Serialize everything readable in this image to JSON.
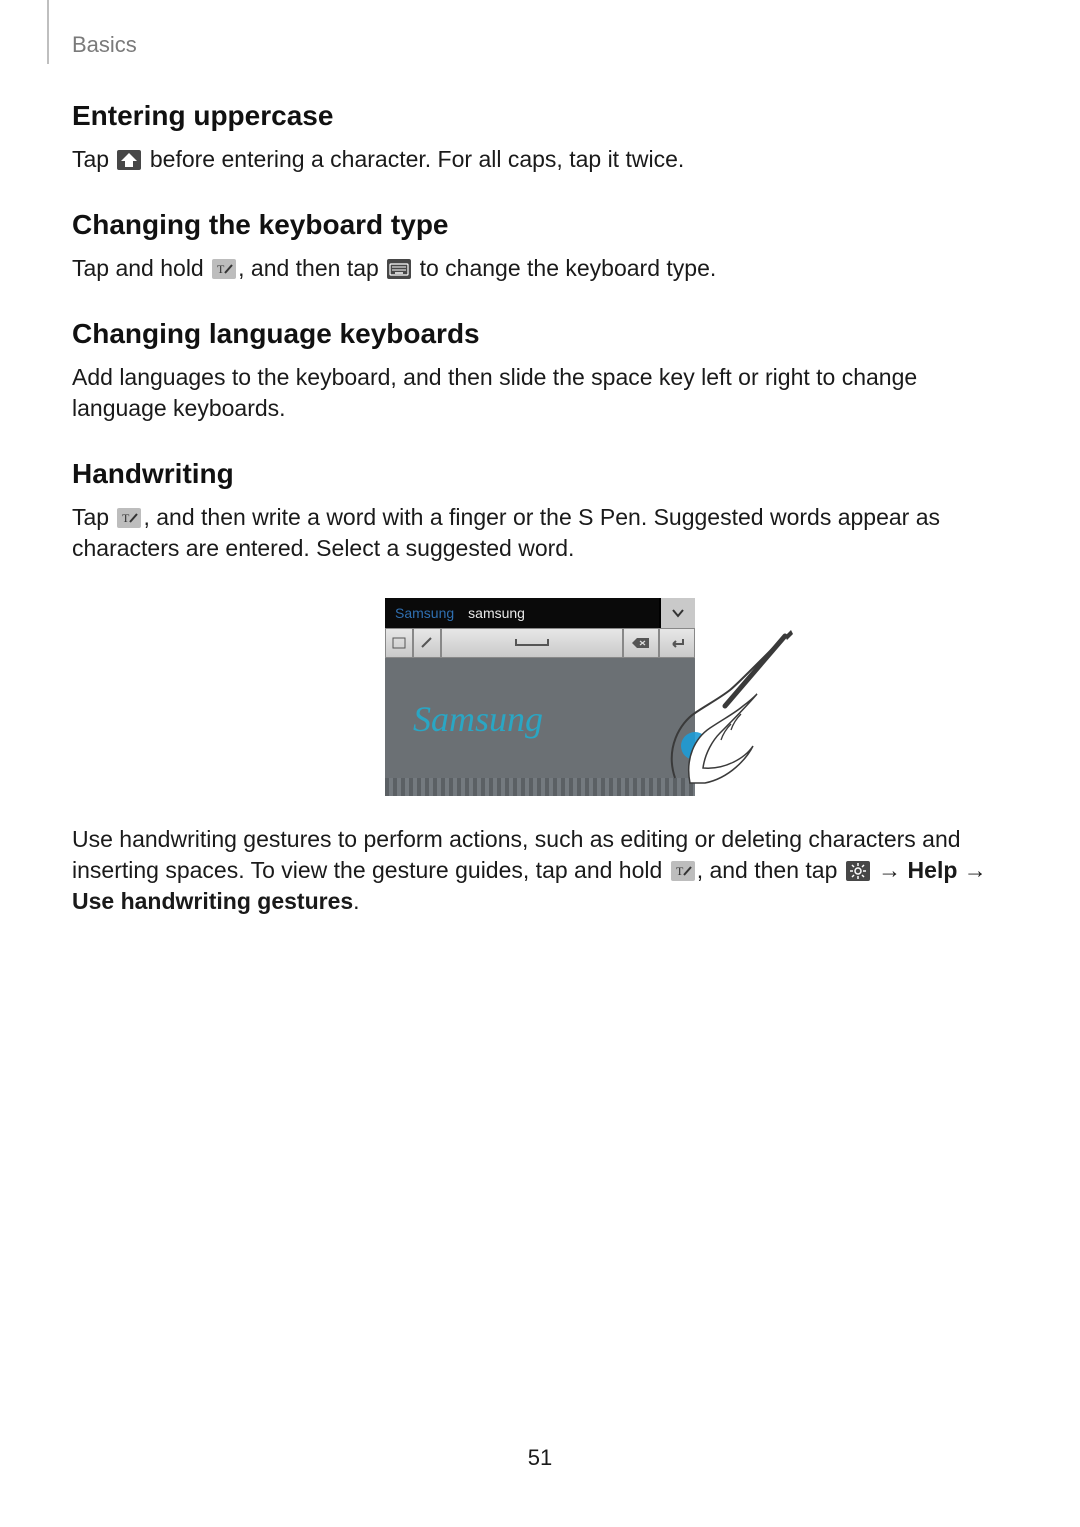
{
  "header": {
    "section": "Basics"
  },
  "sections": [
    {
      "heading": "Entering uppercase",
      "para1_a": "Tap ",
      "icon1": "shift-icon",
      "para1_b": " before entering a character. For all caps, tap it twice."
    },
    {
      "heading": "Changing the keyboard type",
      "para2_a": "Tap and hold ",
      "icon2a": "t-pen-icon",
      "para2_b": ", and then tap ",
      "icon2b": "keyboard-icon",
      "para2_c": " to change the keyboard type."
    },
    {
      "heading": "Changing language keyboards",
      "para3": "Add languages to the keyboard, and then slide the space key left or right to change language keyboards."
    },
    {
      "heading": "Handwriting",
      "para4_a": "Tap ",
      "icon4": "t-pen-icon",
      "para4_b": ", and then write a word with a finger or the S Pen. Suggested words appear as characters are entered. Select a suggested word."
    },
    {
      "para5_a": "Use handwriting gestures to perform actions, such as editing or deleting characters and inserting spaces. To view the gesture guides, tap and hold ",
      "icon5a": "t-pen-icon",
      "para5_b": ", and then tap ",
      "icon5b": "settings-icon",
      "arrow": " → ",
      "help": "Help",
      "arrow2": " → ",
      "gestures": "Use handwriting gestures",
      "period": "."
    }
  ],
  "figure": {
    "suggestion_primary": "Samsung",
    "suggestion_secondary": "samsung",
    "handwritten_text": "Samsung"
  },
  "page_number": "51"
}
